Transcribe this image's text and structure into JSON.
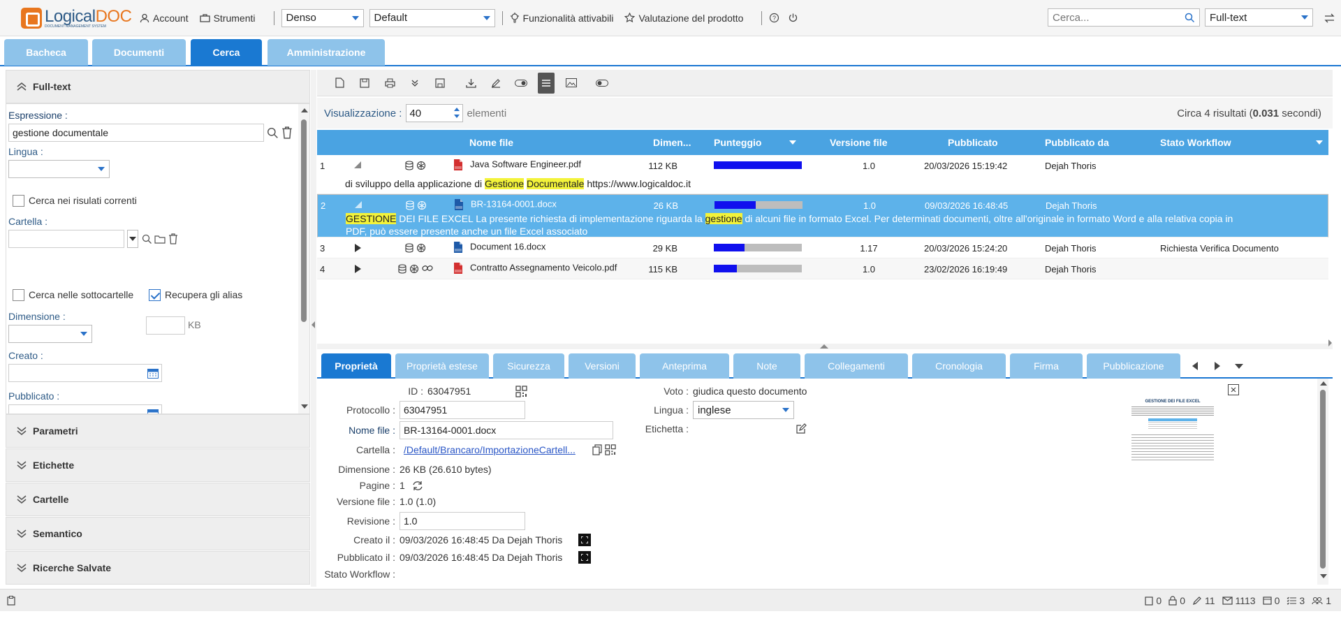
{
  "app": {
    "logo_main": "Logical",
    "logo_accent": "DOC",
    "logo_tagline": "DOCUMENT MANAGEMENT SYSTEM"
  },
  "topbar": {
    "account": "Account",
    "tools": "Strumenti",
    "density": "Denso",
    "workspace": "Default",
    "features": "Funzionalità attivabili",
    "rating": "Valutazione del prodotto",
    "search_placeholder": "Cerca...",
    "search_type": "Full-text"
  },
  "main_tabs": [
    "Bacheca",
    "Documenti",
    "Cerca",
    "Amministrazione"
  ],
  "left": {
    "header": "Full-text",
    "expression_label": "Espressione :",
    "expression_value": "gestione documentale",
    "language_label": "Lingua :",
    "search_current_label": "Cerca nei risulati correnti",
    "folder_label": "Cartella :",
    "subfolders_label": "Cerca nelle sottocartelle",
    "aliases_label": "Recupera gli alias",
    "size_label": "Dimensione :",
    "size_unit": "KB",
    "created_label": "Creato :",
    "published_label": "Pubblicato :",
    "sections": [
      "Parametri",
      "Etichette",
      "Cartelle",
      "Semantico",
      "Ricerche Salvate"
    ]
  },
  "results": {
    "view_label": "Visualizzazione :",
    "view_count": "40",
    "view_unit": "elementi",
    "summary_prefix": "Circa 4 risultati (",
    "summary_time": "0.031",
    "summary_suffix": " secondi)",
    "columns": [
      "Nome file",
      "Dimen...",
      "Punteggio",
      "Versione file",
      "Pubblicato",
      "Pubblicato da",
      "Stato Workflow"
    ],
    "rows": [
      {
        "num": "1",
        "name": "Java Software Engineer.pdf",
        "type": "pdf",
        "size": "112 KB",
        "score": 1.0,
        "version": "1.0",
        "published": "20/03/2026 15:19:42",
        "published_by": "Dejah Thoris",
        "workflow": ""
      },
      {
        "num": "2",
        "name": "BR-13164-0001.docx",
        "type": "docx",
        "size": "26 KB",
        "score": 0.47,
        "version": "1.0",
        "published": "09/03/2026 16:48:45",
        "published_by": "Dejah Thoris",
        "workflow": ""
      },
      {
        "num": "3",
        "name": "Document 16.docx",
        "type": "docx",
        "size": "29 KB",
        "score": 0.35,
        "version": "1.17",
        "published": "20/03/2026 15:24:20",
        "published_by": "Dejah Thoris",
        "workflow": "Richiesta Verifica Documento"
      },
      {
        "num": "4",
        "name": "Contratto Assegnamento Veicolo.pdf",
        "type": "pdf",
        "size": "115 KB",
        "score": 0.26,
        "version": "1.0",
        "published": "23/02/2026 16:19:49",
        "published_by": "Dejah Thoris",
        "workflow": ""
      }
    ],
    "snippet1": {
      "a": "di sviluppo della applicazione di ",
      "h1": "Gestione",
      "b": " ",
      "h2": "Documentale",
      "c": " https://www.logicaldoc.it"
    },
    "snippet2": {
      "h1": "GESTIONE",
      "a": " DEI FILE EXCEL La presente richiesta di implementazione riguarda la ",
      "h2": "gestione",
      "b": " di alcuni file in formato Excel. Per determinati documenti, oltre all'originale in formato Word e alla relativa copia in",
      "line2": "PDF, può essere presente anche un file Excel associato"
    }
  },
  "detail_tabs": [
    "Proprietà",
    "Proprietà estese",
    "Sicurezza",
    "Versioni",
    "Anteprima",
    "Note",
    "Collegamenti",
    "Cronologia",
    "Firma",
    "Pubblicazione"
  ],
  "detail": {
    "id_label": "ID :",
    "id_value": "63047951",
    "protocol_label": "Protocollo :",
    "protocol_value": "63047951",
    "filename_label": "Nome file :",
    "filename_value": "BR-13164-0001.docx",
    "folder_label": "Cartella :",
    "folder_value": "/Default/Brancaro/ImportazioneCartell...",
    "size_label": "Dimensione :",
    "size_value": "26 KB (26.610 bytes)",
    "pages_label": "Pagine :",
    "pages_value": "1",
    "fileversion_label": "Versione file :",
    "fileversion_value": "1.0 (1.0)",
    "revision_label": "Revisione :",
    "revision_value": "1.0",
    "created_label": "Creato il :",
    "created_value": "09/03/2026 16:48:45 Da Dejah Thoris",
    "published_label": "Pubblicato il :",
    "published_value": "09/03/2026 16:48:45 Da Dejah Thoris",
    "workflow_label": "Stato Workflow :",
    "vote_label": "Voto :",
    "vote_value": "giudica questo documento",
    "language_label": "Lingua :",
    "language_value": "inglese",
    "tag_label": "Etichetta :",
    "preview_title": "GESTIONE DEI FILE EXCEL"
  },
  "status": {
    "clipboard": "0",
    "locked": "0",
    "edited": "11",
    "messages": "1113",
    "events": "0",
    "tasks": "3",
    "users": "1"
  }
}
